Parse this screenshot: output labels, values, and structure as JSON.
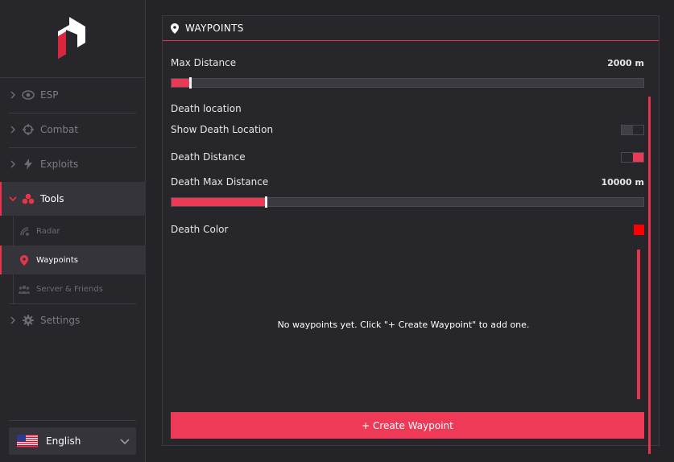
{
  "sidebar": {
    "items": [
      {
        "label": "ESP",
        "icon": "eye-icon"
      },
      {
        "label": "Combat",
        "icon": "crosshair-icon"
      },
      {
        "label": "Exploits",
        "icon": "bolt-icon"
      },
      {
        "label": "Tools",
        "icon": "tools-icon"
      },
      {
        "label": "Settings",
        "icon": "gear-icon"
      }
    ],
    "subitems": [
      {
        "label": "Radar",
        "icon": "radar-icon"
      },
      {
        "label": "Waypoints",
        "icon": "map-pin-icon"
      },
      {
        "label": "Server & Friends",
        "icon": "users-icon"
      }
    ],
    "language": "English"
  },
  "panel": {
    "title": "WAYPOINTS",
    "max_distance": {
      "label": "Max Distance",
      "value": "2000 m",
      "fraction": 0.04
    },
    "section_title": "Death location",
    "show_death_location": {
      "label": "Show Death Location",
      "on": false
    },
    "death_distance": {
      "label": "Death Distance",
      "on": true
    },
    "death_max_distance": {
      "label": "Death Max Distance",
      "value": "10000 m",
      "fraction": 0.2
    },
    "death_color": {
      "label": "Death Color",
      "color": "#ff0000"
    },
    "empty_text": "No waypoints yet. Click \"+ Create Waypoint\" to add one.",
    "create_button": "+  Create Waypoint"
  },
  "colors": {
    "accent": "#e8344a",
    "background": "#232328",
    "panel": "#26262b"
  }
}
